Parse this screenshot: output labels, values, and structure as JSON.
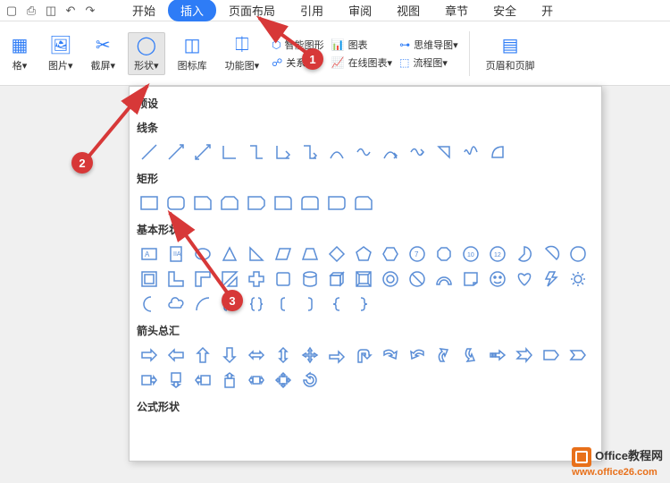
{
  "tabs": {
    "start": "开始",
    "insert": "插入",
    "layout": "页面布局",
    "reference": "引用",
    "review": "审阅",
    "view": "视图",
    "chapter": "章节",
    "security": "安全",
    "dev": "开"
  },
  "ribbon": {
    "table": "格▾",
    "picture": "图片▾",
    "screenshot": "截屏▾",
    "shapes": "形状▾",
    "iconlib": "图标库",
    "funcchart": "功能图▾",
    "smartart": "智能图形",
    "chart": "图表",
    "mindmap": "思维导图▾",
    "relation": "关系图",
    "onlinechart": "在线图表▾",
    "flowchart": "流程图▾",
    "headerfooter": "页眉和页脚"
  },
  "shapes_panel": {
    "presets": "预设",
    "lines": "线条",
    "rectangles": "矩形",
    "basic": "基本形状",
    "arrows": "箭头总汇",
    "formula": "公式形状"
  },
  "annotations": {
    "one": "1",
    "two": "2",
    "three": "3"
  },
  "watermark": {
    "title": "Office教程网",
    "url": "www.office26.com"
  }
}
